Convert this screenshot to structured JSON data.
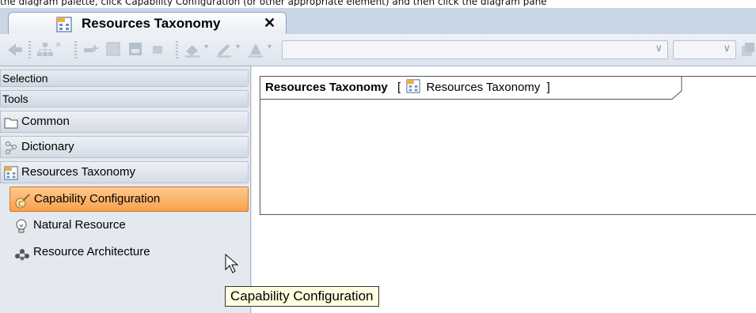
{
  "caption": "the diagram palette, click Capability Configuration (or other appropriate element) and then click the diagram pane",
  "tab": {
    "title": "Resources Taxonomy",
    "close": "✕",
    "icon": "rs-diagram-icon"
  },
  "palette": {
    "headers": [
      "Selection",
      "Tools"
    ],
    "groups": [
      {
        "label": "Common",
        "icon": "folder-icon"
      },
      {
        "label": "Dictionary",
        "icon": "dictionary-icon"
      },
      {
        "label": "Resources Taxonomy",
        "icon": "rs-diagram-icon"
      }
    ],
    "items": [
      {
        "label": "Capability Configuration",
        "icon": "capability-configuration-icon",
        "selected": true
      },
      {
        "label": "Natural Resource",
        "icon": "natural-resource-icon",
        "selected": false
      },
      {
        "label": "Resource Architecture",
        "icon": "resource-architecture-icon",
        "selected": false
      }
    ]
  },
  "diagram": {
    "name": "Resources Taxonomy",
    "bracket_open": "[",
    "bracket_close": "]",
    "type_label": "Resources Taxonomy"
  },
  "tooltip": "Capability Configuration",
  "colors": {
    "selected_item": "#f7a14d",
    "tooltip_bg": "#ffffe1",
    "tab_bar": "#c9d6e6"
  }
}
